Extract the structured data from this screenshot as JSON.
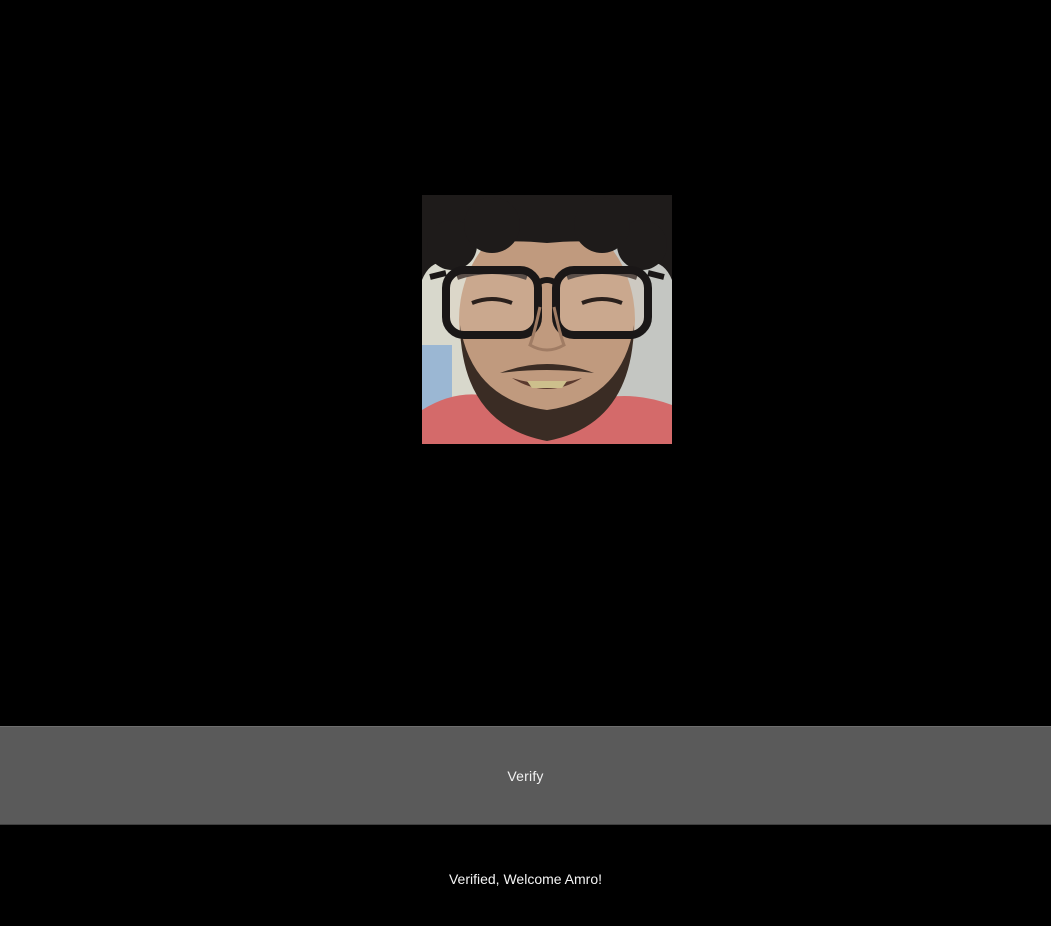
{
  "camera": {
    "preview_icon": "face-photo",
    "background": "#000000"
  },
  "verify_button": {
    "label": "Verify",
    "color": "#5a5a5a"
  },
  "status": {
    "message": "Verified, Welcome Amro!",
    "color": "#f5f5f5"
  }
}
